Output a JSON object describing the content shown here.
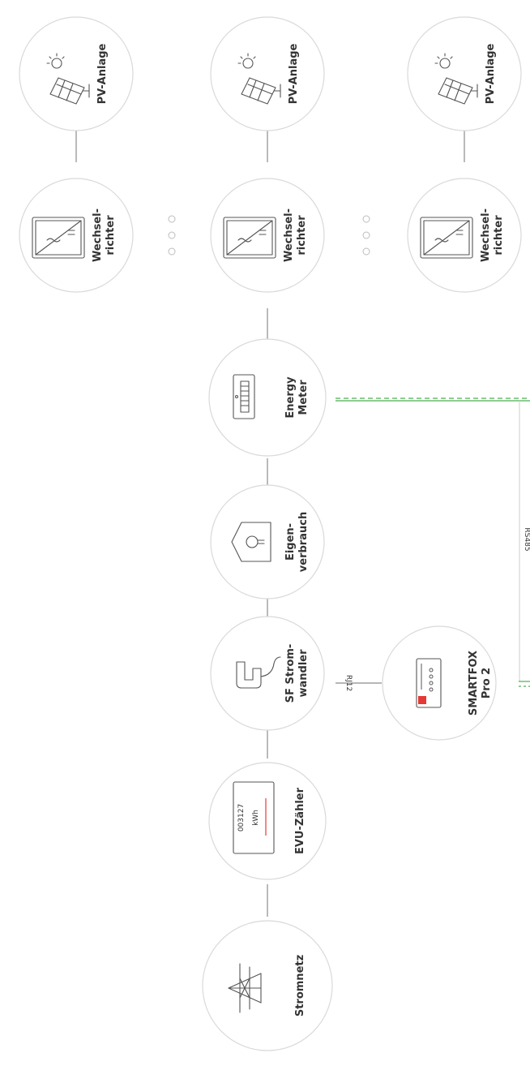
{
  "nodes": {
    "pv1": "PV-Anlage",
    "pv2": "PV-Anlage",
    "pv3": "PV-Anlage",
    "inv1": [
      "Wechsel-",
      "richter"
    ],
    "inv2": [
      "Wechsel-",
      "richter"
    ],
    "inv3": [
      "Wechsel-",
      "richter"
    ],
    "meter": [
      "Energy",
      "Meter"
    ],
    "consumption": [
      "Eigen-",
      "verbrauch"
    ],
    "ct": [
      "SF Strom-",
      "wandler"
    ],
    "utility_meter": "EVU-Zähler",
    "utility_meter_display": {
      "digits": "003127",
      "unit": "kWh"
    },
    "grid": "Stromnetz",
    "smartfox": [
      "SMARTFOX",
      "Pro 2"
    ]
  },
  "connections": {
    "rj12": "RJ12",
    "rs485": "RS485"
  },
  "colors": {
    "circle_stroke": "#d9d9d9",
    "link": "#8c8c8c",
    "rs485_line": "#4caf50",
    "accent_red": "#e53935"
  }
}
